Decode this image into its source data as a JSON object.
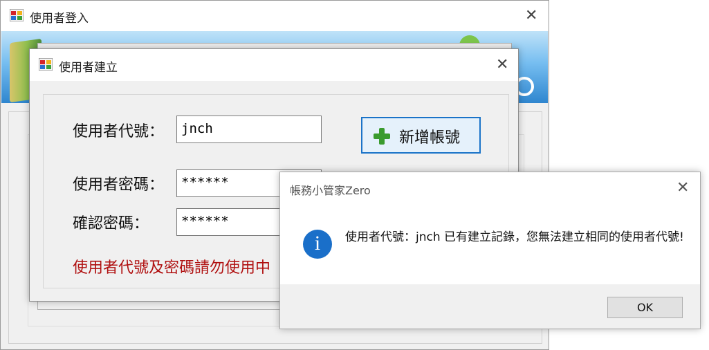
{
  "login_window": {
    "title": "使用者登入",
    "close_glyph": "✕"
  },
  "create_window": {
    "title": "使用者建立",
    "close_glyph": "✕",
    "user_id_label": "使用者代號：",
    "user_id_value": "jnch",
    "password_label": "使用者密碼：",
    "password_value": "******",
    "confirm_label": "確認密碼：",
    "confirm_value": "******",
    "add_button_label": "新增帳號",
    "warning_text": "使用者代號及密碼請勿使用中"
  },
  "message_box": {
    "title": "帳務小管家Zero",
    "close_glyph": "✕",
    "icon_glyph": "i",
    "message": "使用者代號：jnch 已有建立記錄，您無法建立相同的使用者代號!",
    "ok_label": "OK"
  },
  "colors": {
    "accent": "#1a73c8",
    "warning": "#b01010",
    "info_icon": "#1a6fc9",
    "add_icon": "#3a9b2e"
  }
}
